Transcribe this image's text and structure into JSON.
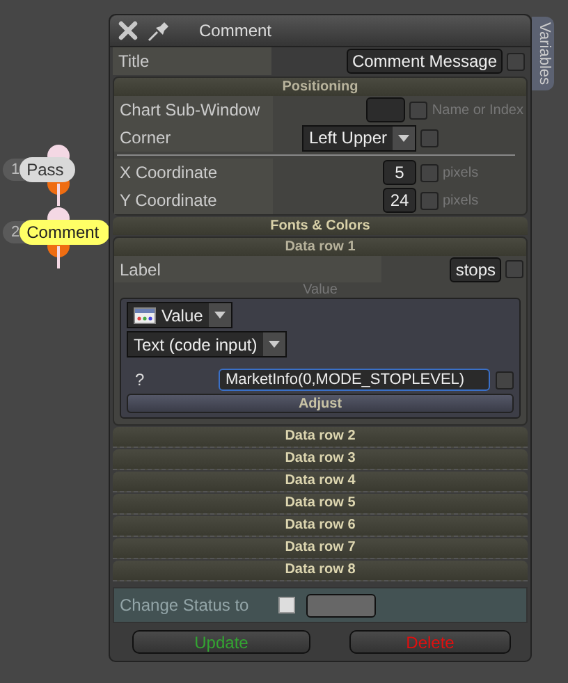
{
  "canvas_nodes": [
    {
      "number": "1",
      "label": "Pass",
      "selected": false
    },
    {
      "number": "2",
      "label": "Comment",
      "selected": true
    }
  ],
  "dialog": {
    "title": "Comment",
    "side_tab": "Variables",
    "title_row": {
      "label": "Title",
      "value": "Comment Message",
      "checked": false
    },
    "positioning": {
      "heading": "Positioning",
      "rows": [
        {
          "kind": "field",
          "label": "Chart Sub-Window",
          "checked": false,
          "unit": "Name or Index"
        },
        {
          "kind": "dropdown",
          "label": "Corner",
          "value": "Left Upper",
          "checked": false
        },
        {
          "kind": "divider"
        },
        {
          "kind": "field",
          "label": "X Coordinate",
          "value": "5",
          "checked": false,
          "unit": "pixels"
        },
        {
          "kind": "field",
          "label": "Y Coordinate",
          "value": "24",
          "checked": false,
          "unit": "pixels"
        }
      ]
    },
    "fonts_heading": "Fonts & Colors",
    "data_rows": [
      {
        "heading": "Data row 1",
        "expanded": true,
        "label": "Label",
        "label_value": "stops",
        "label_checked": false,
        "caption": "Value",
        "source": "Value",
        "mode": "Text (code input)",
        "param_label": "?",
        "param_value": "MarketInfo(0,MODE_STOPLEVEL)",
        "param_checked": false,
        "adjust": "Adjust"
      },
      {
        "heading": "Data row 2",
        "expanded": false
      },
      {
        "heading": "Data row 3",
        "expanded": false
      },
      {
        "heading": "Data row 4",
        "expanded": false
      },
      {
        "heading": "Data row 5",
        "expanded": false
      },
      {
        "heading": "Data row 6",
        "expanded": false
      },
      {
        "heading": "Data row 7",
        "expanded": false
      },
      {
        "heading": "Data row 8",
        "expanded": false
      }
    ],
    "status": {
      "label": "Change Status to",
      "checked": false
    },
    "buttons": [
      {
        "label": "Update",
        "color": "#33a532"
      },
      {
        "label": "Delete",
        "color": "#e00f0f"
      }
    ]
  }
}
